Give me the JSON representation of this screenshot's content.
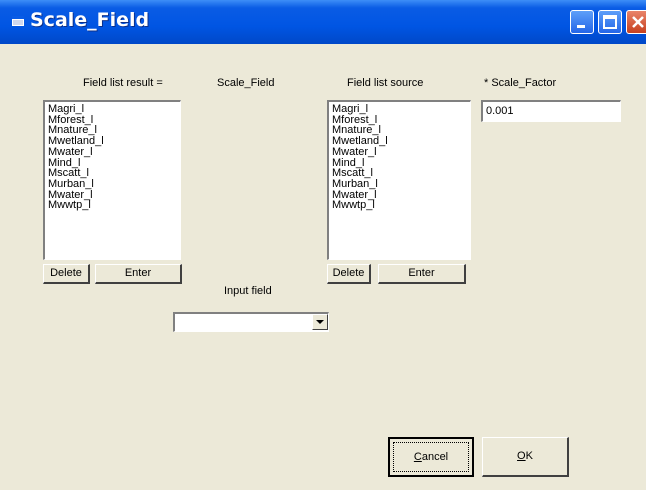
{
  "window": {
    "title": "Scale_Field"
  },
  "labels": {
    "result": "Field list result =",
    "scale_field": "Scale_Field",
    "source": "Field list source",
    "scale_factor": "* Scale_Factor",
    "input_field": "Input field"
  },
  "result_list": [
    "Magri_l",
    "Mforest_l",
    "Mnature_l",
    "Mwetland_l",
    "Mwater_l",
    "Mind_l",
    "Mscatt_l",
    "Murban_l",
    "Mwater_l",
    "Mwwtp_l"
  ],
  "source_list": [
    "Magri_l",
    "Mforest_l",
    "Mnature_l",
    "Mwetland_l",
    "Mwater_l",
    "Mind_l",
    "Mscatt_l",
    "Murban_l",
    "Mwater_l",
    "Mwwtp_l"
  ],
  "scale_factor_value": "0.001",
  "input_field_value": "",
  "buttons": {
    "delete": "Delete",
    "enter": "Enter",
    "cancel_pre": "",
    "cancel_ul": "C",
    "cancel_post": "ancel",
    "ok_ul": "O",
    "ok_post": "K"
  }
}
